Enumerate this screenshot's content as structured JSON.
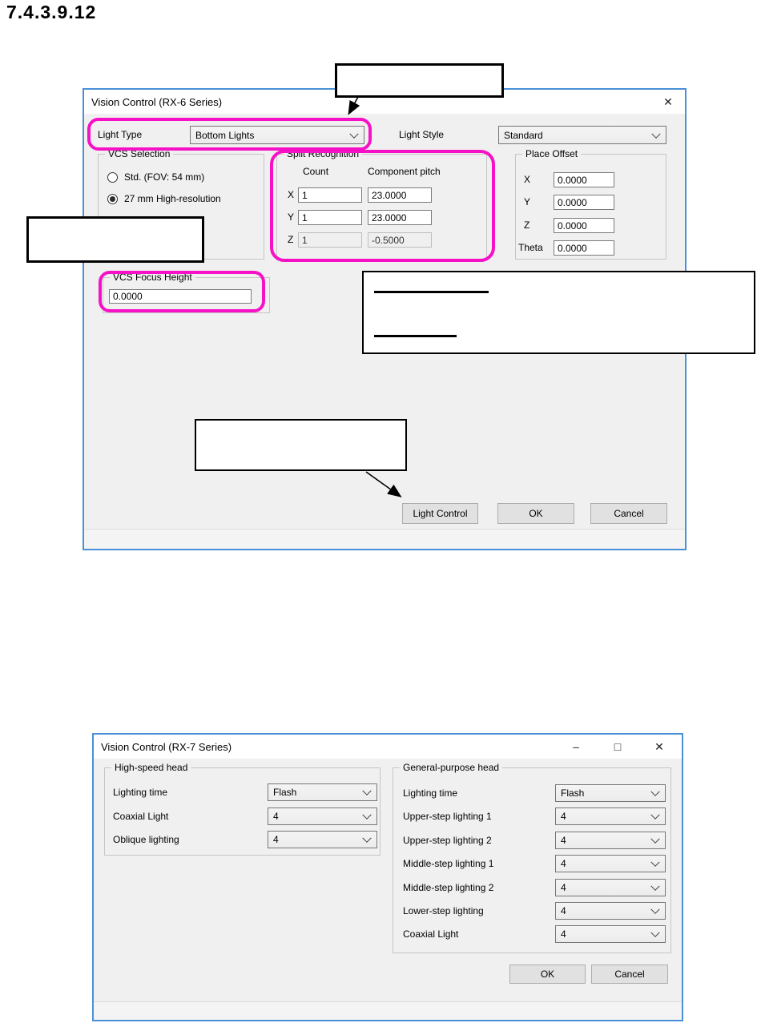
{
  "page": {
    "heading": "7.4.3.9.12"
  },
  "colors": {
    "window_border": "#4a90d9",
    "highlight": "#f711c6"
  },
  "dialog_rx6": {
    "title": "Vision Control (RX-6 Series)",
    "close_icon": "✕",
    "light_type": {
      "label": "Light Type",
      "value": "Bottom Lights"
    },
    "light_style": {
      "label": "Light Style",
      "value": "Standard"
    },
    "vcs_selection": {
      "label": "VCS Selection",
      "options": [
        {
          "label": "Std. (FOV: 54 mm)",
          "selected": false
        },
        {
          "label": "27 mm High-resolution",
          "selected": true
        }
      ]
    },
    "split_recognition": {
      "label": "Split Recognition",
      "col_count": "Count",
      "col_pitch": "Component pitch",
      "rows": [
        {
          "axis": "X",
          "count": "1",
          "pitch": "23.0000",
          "enabled": true
        },
        {
          "axis": "Y",
          "count": "1",
          "pitch": "23.0000",
          "enabled": true
        },
        {
          "axis": "Z",
          "count": "1",
          "pitch": "-0.5000",
          "enabled": false
        }
      ]
    },
    "place_offset": {
      "label": "Place Offset",
      "rows": [
        {
          "axis": "X",
          "value": "0.0000"
        },
        {
          "axis": "Y",
          "value": "0.0000"
        },
        {
          "axis": "Z",
          "value": "0.0000"
        },
        {
          "axis": "Theta",
          "value": "0.0000"
        }
      ]
    },
    "vcs_focus_height": {
      "label": "VCS Focus Height",
      "value": "0.0000"
    },
    "buttons": {
      "light_control": "Light Control",
      "ok": "OK",
      "cancel": "Cancel"
    }
  },
  "dialog_rx7": {
    "title": "Vision Control (RX-7 Series)",
    "minimize_icon": "–",
    "maximize_icon": "□",
    "close_icon": "✕",
    "high_speed_head": {
      "label": "High-speed head",
      "rows": [
        {
          "label": "Lighting time",
          "value": "Flash"
        },
        {
          "label": "Coaxial Light",
          "value": "4"
        },
        {
          "label": "Oblique lighting",
          "value": "4"
        }
      ]
    },
    "general_purpose_head": {
      "label": "General-purpose head",
      "rows": [
        {
          "label": "Lighting time",
          "value": "Flash"
        },
        {
          "label": "Upper-step lighting 1",
          "value": "4"
        },
        {
          "label": "Upper-step lighting 2",
          "value": "4"
        },
        {
          "label": "Middle-step lighting 1",
          "value": "4"
        },
        {
          "label": "Middle-step lighting 2",
          "value": "4"
        },
        {
          "label": "Lower-step lighting",
          "value": "4"
        },
        {
          "label": "Coaxial Light",
          "value": "4"
        }
      ]
    },
    "buttons": {
      "ok": "OK",
      "cancel": "Cancel"
    }
  }
}
